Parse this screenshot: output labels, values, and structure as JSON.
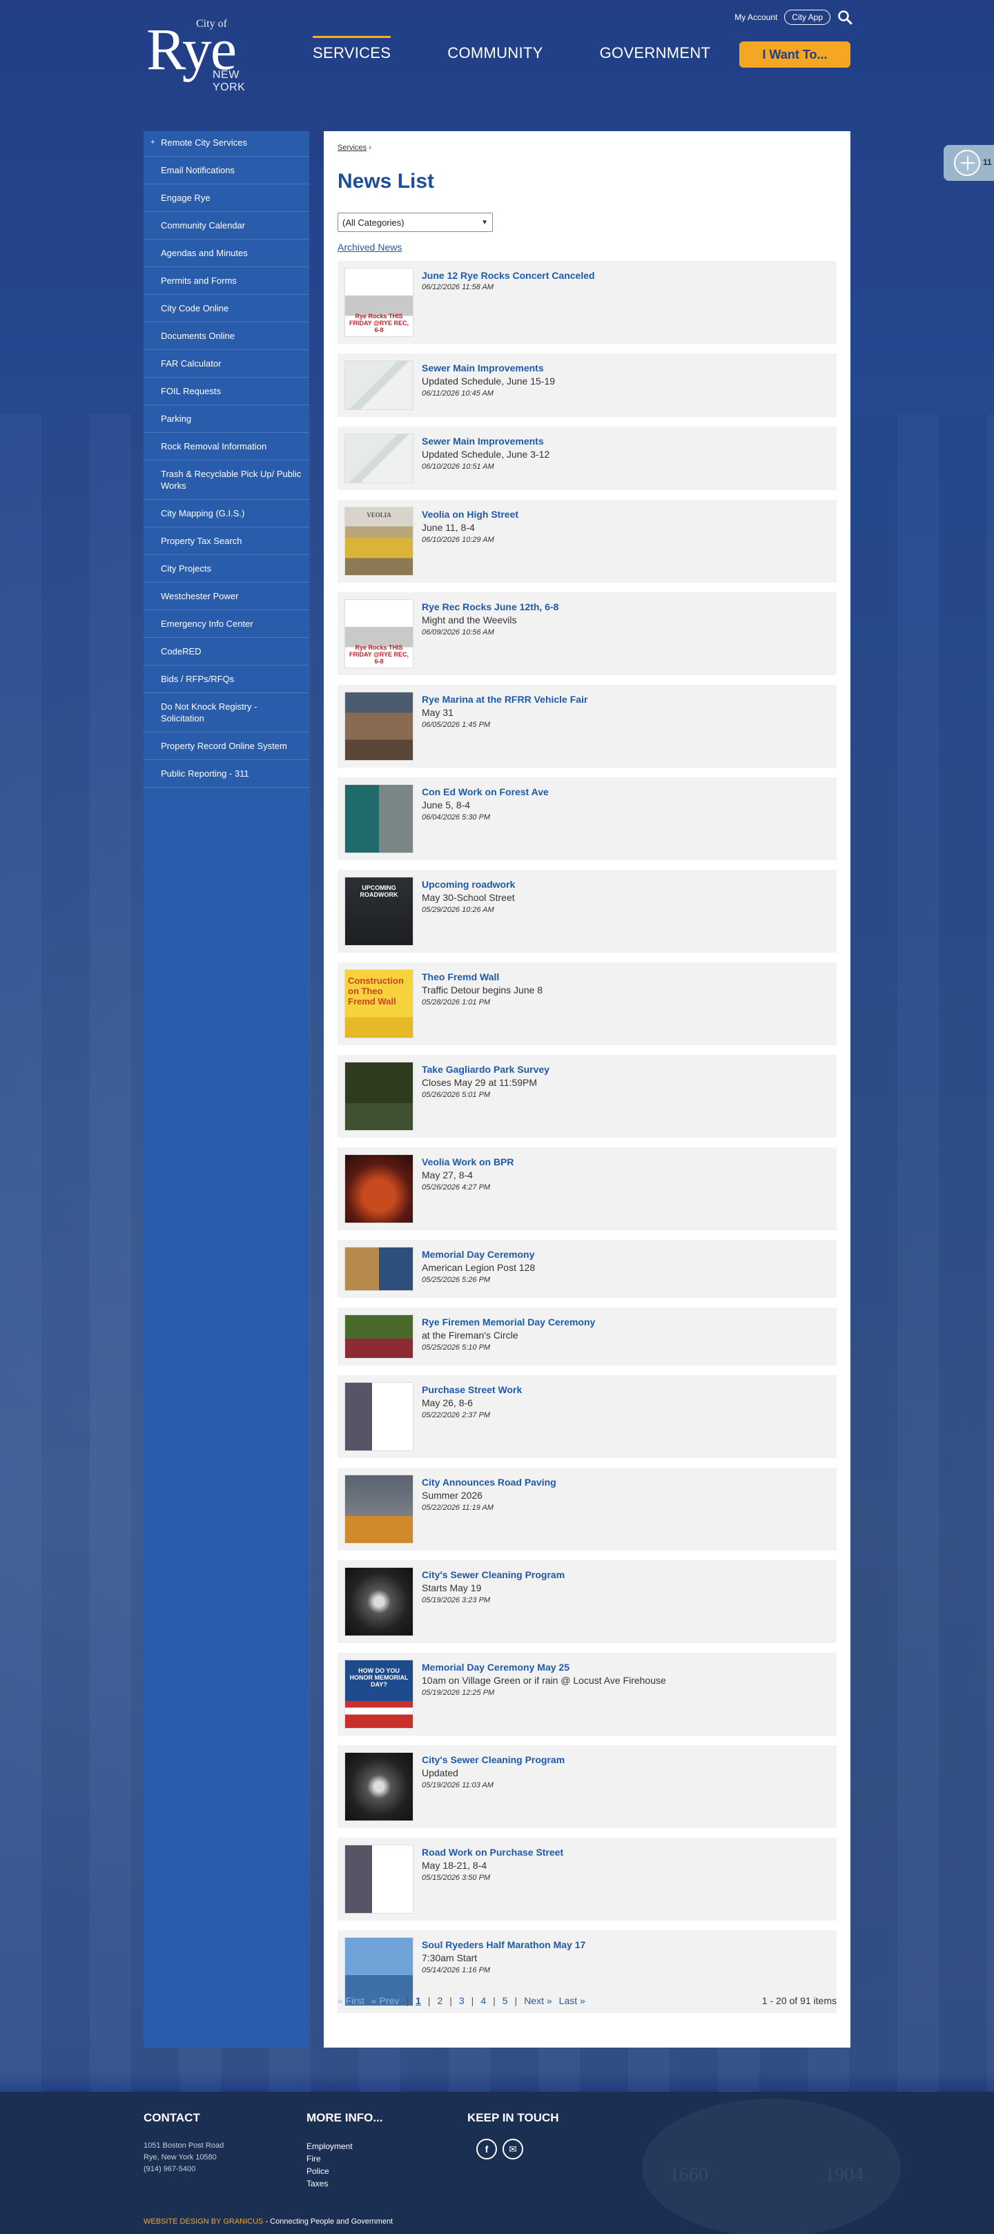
{
  "header": {
    "logo_city_of": "City of",
    "logo_rye": "Rye",
    "logo_ny": "NEW YORK",
    "my_account": "My Account",
    "city_app": "City App",
    "nav": [
      "SERVICES",
      "COMMUNITY",
      "GOVERNMENT"
    ],
    "i_want_to": "I Want To..."
  },
  "sidebar": {
    "items": [
      "Remote City Services",
      "Email Notifications",
      "Engage Rye",
      "Community Calendar",
      "Agendas and Minutes",
      "Permits and Forms",
      "City Code Online",
      "Documents Online",
      "FAR Calculator",
      "FOIL Requests",
      "Parking",
      "Rock Removal Information",
      "Trash & Recyclable Pick Up/ Public Works",
      "City Mapping (G.I.S.)",
      "Property Tax Search",
      "City Projects",
      "Westchester Power",
      "Emergency Info Center",
      "CodeRED",
      "Bids / RFPs/RFQs",
      "Do Not Knock Registry - Solicitation",
      "Property Record Online System",
      "Public Reporting - 311"
    ]
  },
  "main": {
    "breadcrumb": "Services",
    "breadcrumb_sep": "›",
    "title": "News List",
    "category_select": "(All Categories)",
    "archived": "Archived News",
    "news": [
      {
        "title": "June 12 Rye Rocks Concert Canceled",
        "sub": "",
        "date": "06/12/2026 11:58 AM",
        "thumb": "t-concert",
        "thumb_label": "Rye Rocks THIS FRIDAY @RYE REC, 6-8"
      },
      {
        "title": "Sewer Main Improvements",
        "sub": "Updated Schedule, June 15-19",
        "date": "06/11/2026 10:45 AM",
        "thumb": "t-map",
        "thumb_label": ""
      },
      {
        "title": "Sewer Main Improvements",
        "sub": "Updated Schedule, June 3-12",
        "date": "06/10/2026 10:51 AM",
        "thumb": "t-map",
        "thumb_label": ""
      },
      {
        "title": "Veolia on High Street",
        "sub": "June 11, 8-4",
        "date": "06/10/2026 10:29 AM",
        "thumb": "t-road",
        "thumb_label": "VEOLIA"
      },
      {
        "title": "Rye Rec Rocks June 12th, 6-8",
        "sub": "Might and the Weevils",
        "date": "06/09/2026 10:56 AM",
        "thumb": "t-concert",
        "thumb_label": "Rye Rocks THIS FRIDAY @RYE REC, 6-8"
      },
      {
        "title": "Rye Marina at the RFRR Vehicle Fair",
        "sub": "May 31",
        "date": "06/05/2026 1:45 PM",
        "thumb": "t-people",
        "thumb_label": ""
      },
      {
        "title": "Con Ed Work on Forest Ave",
        "sub": "June 5, 8-4",
        "date": "06/04/2026 5:30 PM",
        "thumb": "t-green",
        "thumb_label": ""
      },
      {
        "title": "Upcoming roadwork",
        "sub": "May 30-School Street",
        "date": "05/29/2026 10:26 AM",
        "thumb": "t-dark",
        "thumb_label": "UPCOMING ROADWORK"
      },
      {
        "title": "Theo Fremd Wall",
        "sub": "Traffic Detour begins June 8",
        "date": "05/28/2026 1:01 PM",
        "thumb": "t-yellow",
        "thumb_label": "Construction on Theo Fremd Wall"
      },
      {
        "title": "Take Gagliardo Park Survey",
        "sub": "Closes May 29 at 11:59PM",
        "date": "05/26/2026 5:01 PM",
        "thumb": "t-survey",
        "thumb_label": ""
      },
      {
        "title": "Veolia Work on BPR",
        "sub": "May 27, 8-4",
        "date": "05/26/2026 4:27 PM",
        "thumb": "t-fire",
        "thumb_label": ""
      },
      {
        "title": "Memorial Day Ceremony",
        "sub": "American Legion Post 128",
        "date": "05/25/2026 5:26 PM",
        "thumb": "t-ceremony",
        "thumb_label": ""
      },
      {
        "title": "Rye Firemen Memorial Day Ceremony",
        "sub": "at the Fireman's Circle",
        "date": "05/25/2026 5:10 PM",
        "thumb": "t-memorial",
        "thumb_label": ""
      },
      {
        "title": "Purchase Street Work",
        "sub": "May 26, 8-6",
        "date": "05/22/2026 2:37 PM",
        "thumb": "t-flyer",
        "thumb_label": ""
      },
      {
        "title": "City Announces Road Paving",
        "sub": "Summer 2026",
        "date": "05/22/2026 11:19 AM",
        "thumb": "t-paving",
        "thumb_label": ""
      },
      {
        "title": "City's Sewer Cleaning Program",
        "sub": "Starts May 19",
        "date": "05/19/2026 3:23 PM",
        "thumb": "t-tunnel",
        "thumb_label": ""
      },
      {
        "title": "Memorial Day Ceremony May 25",
        "sub": "10am on Village Green or if rain @ Locust Ave Firehouse",
        "date": "05/19/2026 12:25 PM",
        "thumb": "t-flag",
        "thumb_label": "HOW DO YOU HONOR MEMORIAL DAY?"
      },
      {
        "title": "City's Sewer Cleaning Program",
        "sub": "Updated",
        "date": "05/19/2026 11:03 AM",
        "thumb": "t-tunnel",
        "thumb_label": ""
      },
      {
        "title": "Road Work on Purchase Street",
        "sub": "May 18-21, 8-4",
        "date": "05/15/2026 3:50 PM",
        "thumb": "t-flyer",
        "thumb_label": ""
      },
      {
        "title": "Soul Ryeders Half Marathon May 17",
        "sub": "7:30am Start",
        "date": "05/14/2026 1:16 PM",
        "thumb": "t-half",
        "thumb_label": ""
      }
    ],
    "pager": {
      "first": "« First",
      "prev": "« Prev",
      "pages": [
        "1",
        "2",
        "3",
        "4",
        "5"
      ],
      "next": "Next »",
      "last": "Last »",
      "count": "1 - 20 of 91 items"
    }
  },
  "widget": {
    "label": "11"
  },
  "footer": {
    "contact_heading": "CONTACT",
    "contact_lines": [
      "1051 Boston Post Road",
      "Rye, New York 10580",
      "(914) 967-5400"
    ],
    "more_heading": "MORE INFO...",
    "more_links": [
      "Employment",
      "Fire",
      "Police",
      "Taxes"
    ],
    "keep_heading": "KEEP IN TOUCH",
    "seal_year1": "1660",
    "seal_year2": "1904",
    "credit_brand": "WEBSITE DESIGN BY GRANICUS",
    "credit_text": " - Connecting People and Government"
  },
  "colors": {
    "brand_blue": "#1e3f87",
    "accent_gold": "#f5a623",
    "link_blue": "#1e5aa8",
    "sidebar_blue": "#2a5cac"
  }
}
